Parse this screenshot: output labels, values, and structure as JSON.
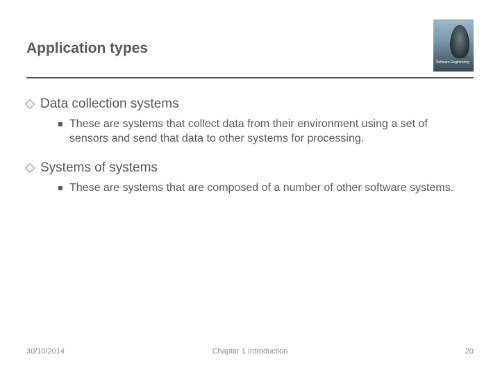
{
  "slide": {
    "title": "Application types",
    "logo_caption": "Software Engineering",
    "bullets": [
      {
        "heading": "Data collection systems",
        "sub": "These are systems that collect data from their environment using a set of sensors and send that data to other systems for processing."
      },
      {
        "heading": "Systems of systems",
        "sub": "These are systems that are composed of a number of other software systems."
      }
    ],
    "footer": {
      "date": "30/10/2014",
      "chapter": "Chapter 1 Introduction",
      "page": "20"
    }
  }
}
